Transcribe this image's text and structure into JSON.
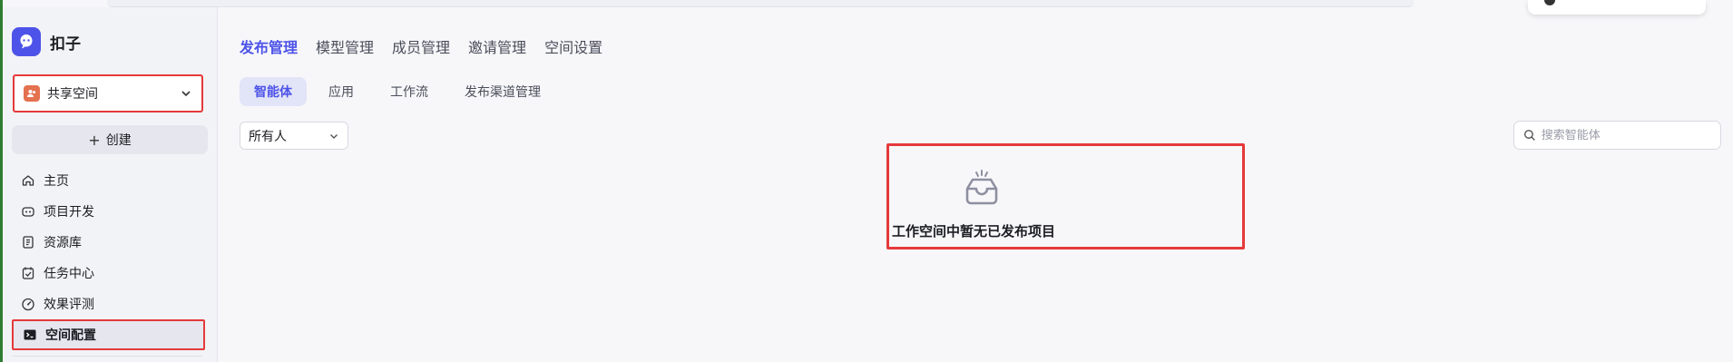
{
  "app": {
    "name": "扣子"
  },
  "sidebar": {
    "space_selector": {
      "label": "共享空间"
    },
    "create_button": {
      "plus": "+",
      "label": "创建"
    },
    "items": [
      {
        "label": "主页",
        "icon": "home-icon"
      },
      {
        "label": "项目开发",
        "icon": "robot-icon"
      },
      {
        "label": "资源库",
        "icon": "library-icon"
      },
      {
        "label": "任务中心",
        "icon": "task-check-icon"
      },
      {
        "label": "效果评测",
        "icon": "gauge-icon"
      },
      {
        "label": "空间配置",
        "icon": "terminal-icon",
        "active": true
      }
    ]
  },
  "main": {
    "tabs": [
      {
        "label": "发布管理",
        "active": true
      },
      {
        "label": "模型管理"
      },
      {
        "label": "成员管理"
      },
      {
        "label": "邀请管理"
      },
      {
        "label": "空间设置"
      }
    ],
    "sub_tabs": [
      {
        "label": "智能体",
        "active": true
      },
      {
        "label": "应用"
      },
      {
        "label": "工作流"
      },
      {
        "label": "发布渠道管理"
      }
    ],
    "owner_filter": {
      "value": "所有人"
    },
    "search": {
      "placeholder": "搜索智能体",
      "value": ""
    },
    "empty_state": {
      "message": "工作空间中暂无已发布项目",
      "icon": "empty-inbox-icon"
    }
  },
  "colors": {
    "accent": "#4d53e8",
    "highlight_border": "#e5393b",
    "space_badge": "#e4714f"
  }
}
